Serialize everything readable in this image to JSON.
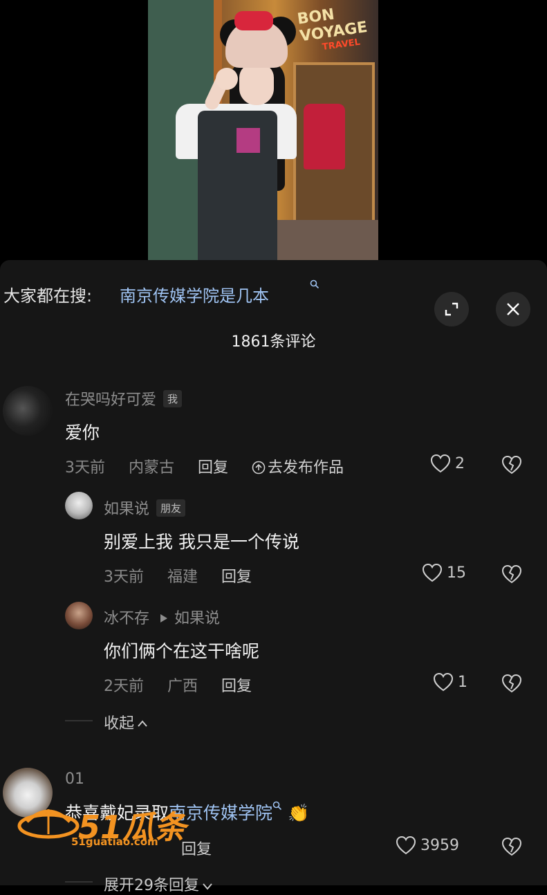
{
  "search": {
    "prefix": "大家都在搜:",
    "query": "南京传媒学院是几本"
  },
  "comment_count": "1861条评论",
  "comments": [
    {
      "user": "在哭吗好可爱",
      "tag": "我",
      "text": "爱你",
      "time": "3天前",
      "location": "内蒙古",
      "reply": "回复",
      "extra": "去发布作品",
      "likes": "2",
      "replies": [
        {
          "user": "如果说",
          "tag": "朋友",
          "text": "别爱上我 我只是一个传说",
          "time": "3天前",
          "location": "福建",
          "reply": "回复",
          "likes": "15"
        },
        {
          "user": "冰不存",
          "reply_to": "如果说",
          "text": "你们俩个在这干啥呢",
          "time": "2天前",
          "location": "广西",
          "reply": "回复",
          "likes": "1"
        }
      ],
      "collapse": "收起"
    },
    {
      "user": "01",
      "text_prefix": "恭喜戴妃录取",
      "text_link": "南京传媒学院",
      "text_emoji": "👏",
      "reply": "回复",
      "likes": "3959",
      "expand": "展开29条回复"
    }
  ],
  "video_sign": {
    "line1": "BON VOYAGE",
    "line2": "TRAVEL"
  },
  "watermark": {
    "brand": "51瓜条",
    "url": "51guatiao.com"
  },
  "colors": {
    "panel_bg": "#161616",
    "link": "#9fc3f2",
    "muted": "#8a8a8a",
    "watermark": "#f39321"
  }
}
